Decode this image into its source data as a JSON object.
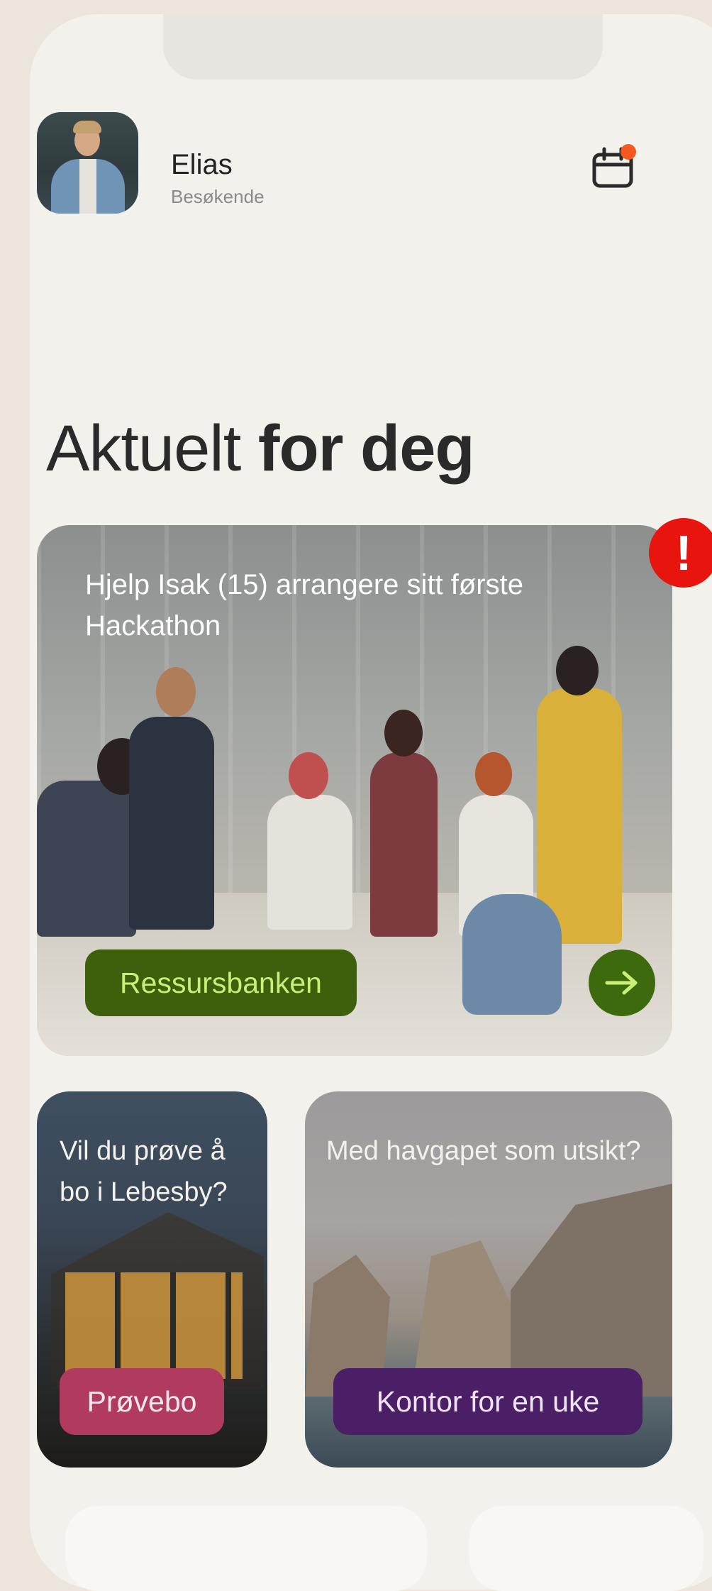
{
  "user": {
    "name": "Elias",
    "role": "Besøkende"
  },
  "header": {
    "calendar_icon": "calendar-icon",
    "notification_dot_color": "#f4581f"
  },
  "section": {
    "title_regular": "Aktuelt",
    "title_bold": "for deg"
  },
  "featured_card": {
    "title": "Hjelp Isak (15) arrangere sitt første Hackathon",
    "tag": "Ressursbanken",
    "tag_color": "#3e5f0b",
    "arrow_icon": "arrow-right-icon",
    "alert_badge": "!"
  },
  "cards": [
    {
      "title": "Vil du prøve å bo i Lebesby?",
      "tag": "Prøvebo",
      "tag_color": "#b13b5e"
    },
    {
      "title": "Med havgapet som utsikt?",
      "tag": "Kontor for en uke",
      "tag_color": "#4a1f66"
    }
  ]
}
